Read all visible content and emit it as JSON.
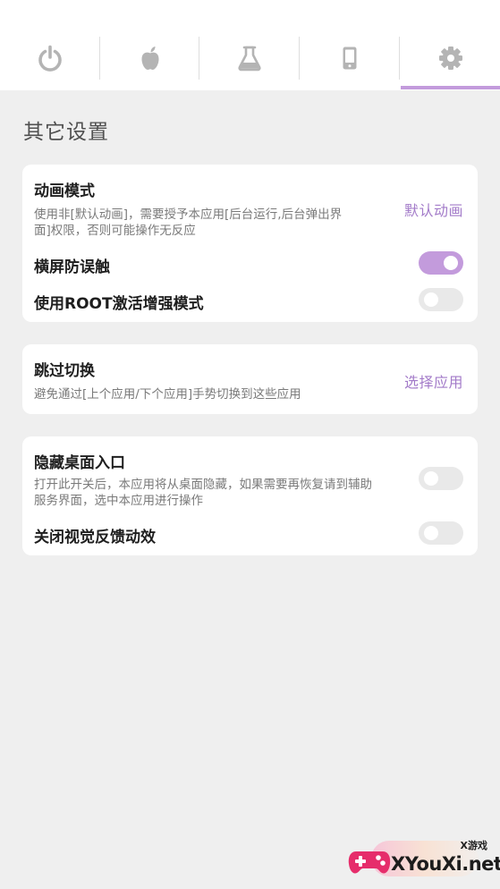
{
  "tabs": [
    {
      "icon": "power-icon",
      "selected": false
    },
    {
      "icon": "apple-icon",
      "selected": false
    },
    {
      "icon": "flask-icon",
      "selected": false
    },
    {
      "icon": "phone-icon",
      "selected": false
    },
    {
      "icon": "gear-icon",
      "selected": true
    }
  ],
  "colors": {
    "accent": "#c39bdc",
    "accent_text": "#a37bc9",
    "icon": "#b4b4b4",
    "background": "#efefef"
  },
  "section_title": "其它设置",
  "card1": {
    "animation_mode": {
      "title": "动画模式",
      "desc_line1": "使用非[默认动画]，需要授予本应用[后台运行,后台弹出界",
      "desc_line2": "面]权限，否则可能操作无反应",
      "value": "默认动画"
    },
    "landscape_guard": {
      "title": "横屏防误触",
      "enabled": true
    },
    "root_mode": {
      "title": "使用ROOT激活增强模式",
      "enabled": false
    }
  },
  "card2": {
    "skip_switch": {
      "title": "跳过切换",
      "desc": "避免通过[上个应用/下个应用]手势切换到这些应用",
      "value": "选择应用"
    }
  },
  "card3": {
    "hide_launcher": {
      "title": "隐藏桌面入口",
      "desc_line1": "打开此开关后，本应用将从桌面隐藏，如果需要再恢复请到辅助",
      "desc_line2": "服务界面，选中本应用进行操作",
      "enabled": false
    },
    "disable_feedback": {
      "title": "关闭视觉反馈动效",
      "enabled": false
    }
  },
  "watermark": {
    "small_text": "X游戏",
    "main_text": "XYouXi.net"
  }
}
